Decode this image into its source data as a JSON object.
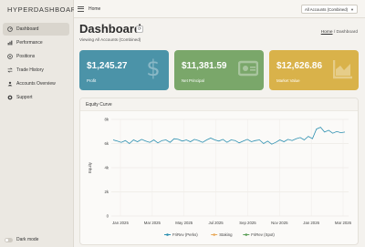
{
  "app": {
    "brand": "HYPERDASHBOARD"
  },
  "sidebar": {
    "items": [
      {
        "label": "Dashboard",
        "icon": "dashboard-icon",
        "active": true
      },
      {
        "label": "Performance",
        "icon": "performance-icon",
        "active": false
      },
      {
        "label": "Positions",
        "icon": "positions-icon",
        "active": false
      },
      {
        "label": "Trade History",
        "icon": "trade-history-icon",
        "active": false
      },
      {
        "label": "Accounts Overview",
        "icon": "accounts-icon",
        "active": false
      },
      {
        "label": "Support",
        "icon": "support-icon",
        "active": false
      }
    ],
    "dark_mode_label": "Dark mode"
  },
  "topbar": {
    "title": "Home",
    "account_select": "All Accounts (Combined)"
  },
  "page": {
    "title": "Dashboard",
    "subtitle": "Viewing All Accounts (Combined)",
    "breadcrumb_home": "Home",
    "breadcrumb_sep": "/",
    "breadcrumb_current": "Dashboard"
  },
  "cards": [
    {
      "value": "$1,245.27",
      "label": "Profit",
      "color": "#4b93a8",
      "icon": "dollar-icon"
    },
    {
      "value": "$11,381.59",
      "label": "Net Principal",
      "color": "#7aa76a",
      "icon": "money-icon"
    },
    {
      "value": "$12,626.86",
      "label": "Market Value",
      "color": "#d9b24a",
      "icon": "area-chart-icon"
    }
  ],
  "chart": {
    "title": "Equity Curve",
    "chart_data": {
      "type": "line",
      "ylabel": "Equity",
      "ylim": [
        0,
        8
      ],
      "y_unit": "k",
      "y_ticks": [
        "0",
        "2k",
        "4k",
        "6k",
        "8k"
      ],
      "x_ticks": [
        "Jan 2025",
        "Mar 2025",
        "May 2025",
        "Jul 2025",
        "Sep 2025",
        "Nov 2025",
        "Jan 2026",
        "Mar 2026"
      ],
      "series": [
        {
          "name": "FriRev (Perks)",
          "color": "#2c8fb0",
          "values": [
            6.3,
            6.2,
            6.1,
            6.25,
            6.0,
            6.3,
            6.15,
            6.35,
            6.2,
            6.1,
            6.3,
            6.05,
            6.25,
            6.3,
            6.1,
            6.4,
            6.35,
            6.2,
            6.3,
            6.15,
            6.35,
            6.25,
            6.1,
            6.3,
            6.45,
            6.3,
            6.2,
            6.35,
            6.1,
            6.3,
            6.25,
            6.05,
            6.2,
            6.35,
            6.15,
            6.25,
            6.3,
            6.0,
            6.2,
            5.95,
            6.1,
            6.3,
            6.15,
            6.35,
            6.25,
            6.4,
            6.5,
            6.3,
            6.6,
            6.4,
            7.2,
            7.35,
            6.95,
            7.1,
            6.85,
            7.0,
            6.9,
            6.95
          ]
        },
        {
          "name": "Staking",
          "color": "#e8a95a",
          "values": []
        },
        {
          "name": "FriRev (Spot)",
          "color": "#5a9e56",
          "values": []
        }
      ]
    }
  }
}
